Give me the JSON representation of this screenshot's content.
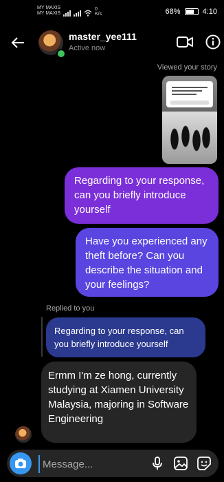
{
  "status_bar": {
    "carrier_1": "MY MAXIS",
    "carrier_2": "MY MAXIS",
    "data_speed": "0",
    "data_unit": "K/s",
    "battery": "68%",
    "time": "4:10"
  },
  "header": {
    "username": "master_yee111",
    "status": "Active now",
    "icons": [
      "back-arrow-icon",
      "video-call-icon",
      "info-icon"
    ]
  },
  "story": {
    "label": "Viewed your story"
  },
  "messages": {
    "outgoing_1": "Regarding to your response, can you briefly introduce yourself",
    "outgoing_2": "Have you experienced any theft before? Can you describe the situation and your feelings?",
    "replied_label": "Replied to you",
    "quoted": "Regarding to your response, can you briefly introduce yourself",
    "incoming_1": "Ermm I'm ze hong, currently studying at Xiamen University Malaysia, majoring in Software Engineering"
  },
  "composer": {
    "placeholder": "Message...",
    "icons": [
      "camera-icon",
      "microphone-icon",
      "gallery-icon",
      "sticker-icon"
    ]
  },
  "colors": {
    "accent": "#3797f0",
    "bubble_out_1": "#7b2fd8",
    "bubble_out_2": "#5a45e0",
    "bubble_quote": "#2b3a8f",
    "bubble_in": "#262626",
    "online": "#3fc45c"
  }
}
